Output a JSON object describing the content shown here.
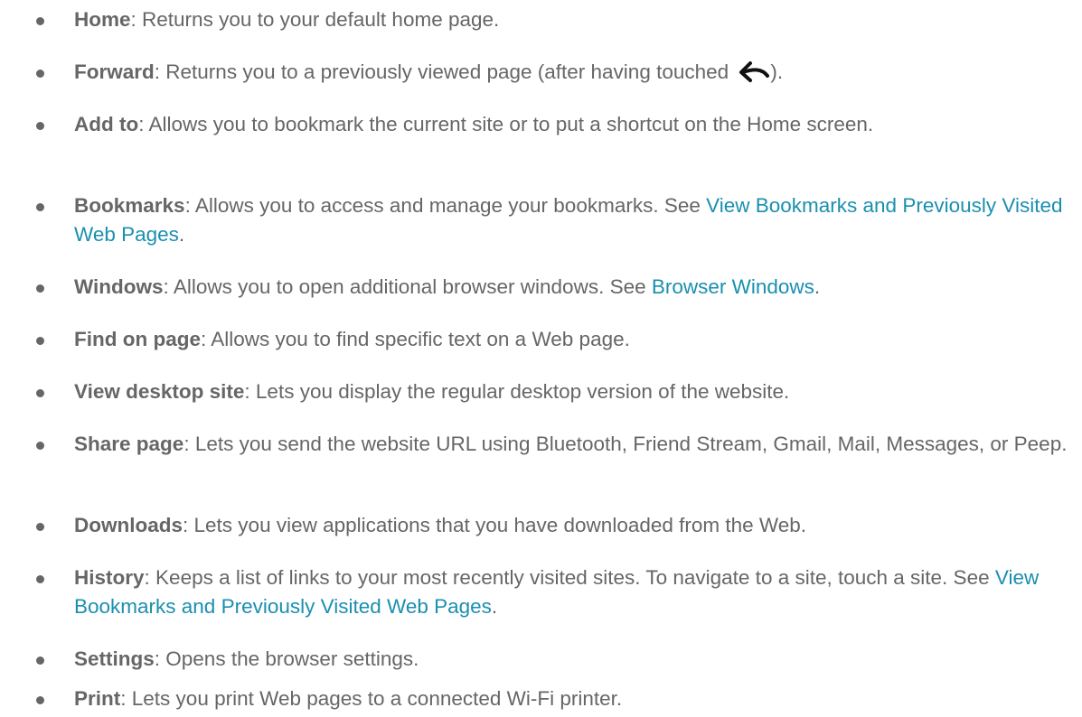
{
  "items": [
    {
      "term": "Home",
      "sep": ": ",
      "text": "Returns you to your default home page."
    },
    {
      "term": "Forward",
      "sep": ": ",
      "text": "Returns you to a previously viewed page (after having touched ",
      "icon": "back-arrow-icon",
      "text_after": ")."
    },
    {
      "term": "Add to",
      "sep": ": ",
      "text": "Allows you to bookmark the current site or to put a shortcut on the Home screen."
    },
    {
      "term": "Bookmarks",
      "sep": ": ",
      "text": "Allows you to access and manage your bookmarks. See ",
      "link": "View Bookmarks and Previously Visited Web Pages",
      "text_after": "."
    },
    {
      "term": "Windows",
      "sep": ": ",
      "text": "Allows you to open additional browser windows. See ",
      "link": "Browser Windows",
      "text_after": "."
    },
    {
      "term": "Find on page",
      "sep": ": ",
      "text": "Allows you to find specific text on a Web page."
    },
    {
      "term": "View desktop site",
      "sep": ": ",
      "text": "Lets you display the regular desktop version of the website."
    },
    {
      "term": "Share page",
      "sep": ": ",
      "text": "Lets you send the website URL using Bluetooth, Friend Stream, Gmail, Mail, Messages, or Peep."
    },
    {
      "term": "Downloads",
      "sep": ": ",
      "text": "Lets you view applications that you have downloaded from the Web."
    },
    {
      "term": "History",
      "sep": ": ",
      "text": "Keeps a list of links to your most recently visited sites. To navigate to a site, touch a site. See ",
      "link": "View Bookmarks and Previously Visited Web Pages",
      "text_after": "."
    },
    {
      "term": "Settings",
      "sep": ": ",
      "text": "Opens the browser settings."
    },
    {
      "term": "Print",
      "sep": ": ",
      "text": "Lets you print Web pages to a connected Wi-Fi printer."
    }
  ],
  "colors": {
    "text": "#666666",
    "link": "#1a8fb0"
  }
}
